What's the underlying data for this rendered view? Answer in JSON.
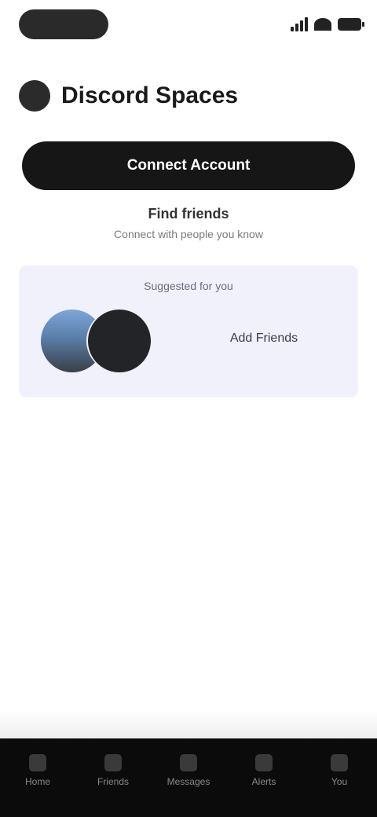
{
  "status_bar": {
    "time": ""
  },
  "header": {
    "title": "Discord Spaces"
  },
  "primary_button": {
    "label": "Connect Account"
  },
  "subtitle": {
    "primary": "Find friends",
    "secondary": "Connect with people you know"
  },
  "card": {
    "title": "Suggested for you",
    "action_label": "Add Friends"
  },
  "bottom_nav": {
    "items": [
      {
        "label": "Home",
        "icon": "home-icon"
      },
      {
        "label": "Friends",
        "icon": "friends-icon"
      },
      {
        "label": "Messages",
        "icon": "messages-icon"
      },
      {
        "label": "Alerts",
        "icon": "bell-icon"
      },
      {
        "label": "You",
        "icon": "profile-icon"
      }
    ]
  },
  "colors": {
    "primary_button": "#161616",
    "card_background": "#f1f1fb",
    "bottom_nav": "#0b0b0b"
  }
}
